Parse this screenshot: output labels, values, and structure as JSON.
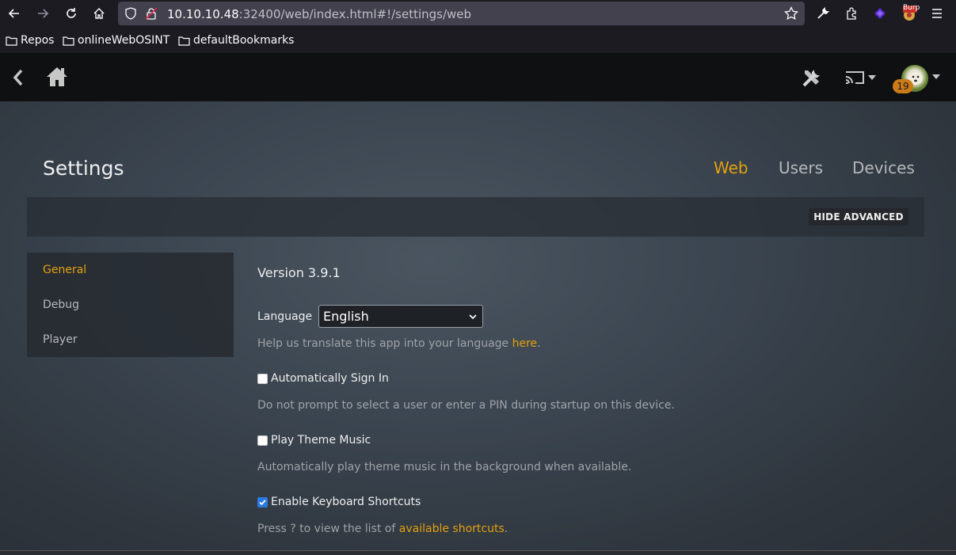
{
  "browser": {
    "url_host": "10.10.10.48",
    "url_rest": ":32400/web/index.html#!/settings/web",
    "bookmarks": [
      "Repos",
      "onlineWebOSINT",
      "defaultBookmarks"
    ],
    "extension_badge": "Burp"
  },
  "header": {
    "notification_count": "19"
  },
  "page": {
    "title": "Settings",
    "tabs": [
      "Web",
      "Users",
      "Devices"
    ],
    "active_tab": "Web",
    "advanced_button": "HIDE ADVANCED"
  },
  "sidebar": {
    "items": [
      "General",
      "Debug",
      "Player"
    ],
    "active": "General"
  },
  "settings": {
    "version": "Version 3.9.1",
    "language_label": "Language",
    "language_value": "English",
    "translate_help": "Help us translate this app into your language ",
    "translate_link": "here",
    "translate_end": ".",
    "options": [
      {
        "label": "Automatically Sign In",
        "checked": false,
        "help": "Do not prompt to select a user or enter a PIN during startup on this device."
      },
      {
        "label": "Play Theme Music",
        "checked": false,
        "help": "Automatically play theme music in the background when available."
      },
      {
        "label": "Enable Keyboard Shortcuts",
        "checked": true,
        "help": "Press ? to view the list of ",
        "help_link": "available shortcuts",
        "help_end": "."
      }
    ]
  },
  "colors": {
    "accent": "#e5a00d",
    "checkbox_checked": "#2a7ae2",
    "header_bg": "#0f1011"
  }
}
